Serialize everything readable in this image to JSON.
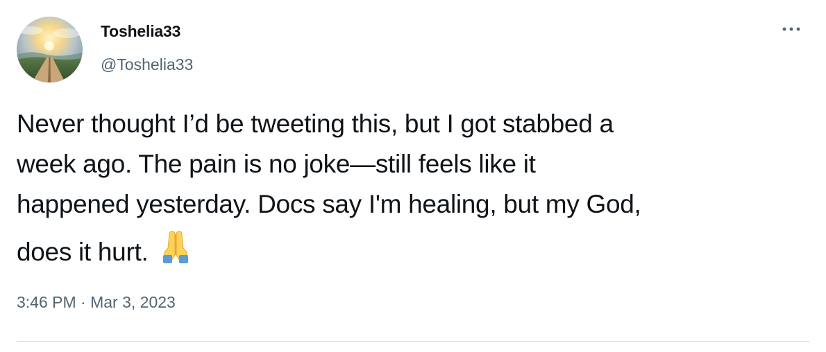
{
  "user": {
    "display_name": "Toshelia33",
    "handle": "@Toshelia33",
    "avatar_icon": "sunset-pathway-avatar"
  },
  "menu": {
    "more_icon": "more-horizontal-icon"
  },
  "tweet": {
    "lines": [
      "Never thought I’d be tweeting this, but I got stabbed a",
      "week ago. The pain is no joke—still feels like it",
      "happened yesterday. Docs say I'm healing, but my God,",
      "does it hurt."
    ],
    "emoji": "folded-hands-emoji",
    "time": "3:46 PM",
    "separator": "·",
    "date": "Mar 3, 2023"
  },
  "colors": {
    "text_primary": "#0f1419",
    "text_secondary": "#536471",
    "divider": "#cfd9de"
  }
}
